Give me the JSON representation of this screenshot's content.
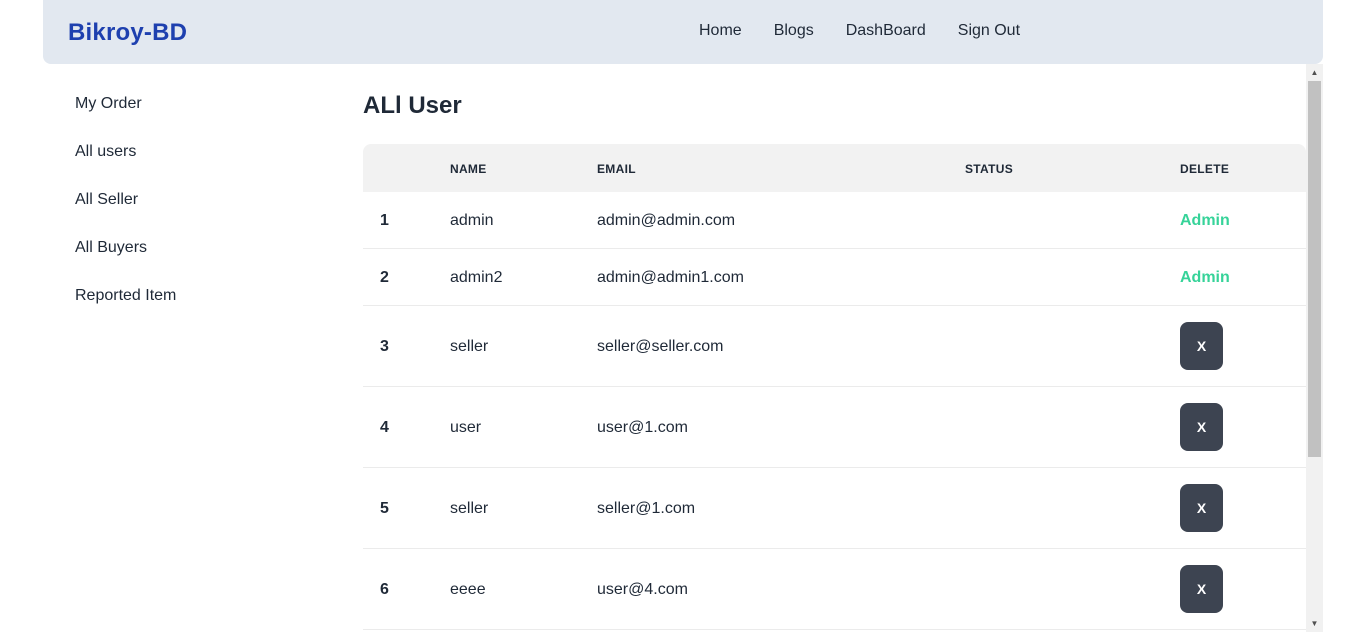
{
  "navbar": {
    "brand": "Bikroy-BD",
    "links": [
      "Home",
      "Blogs",
      "DashBoard",
      "Sign Out"
    ]
  },
  "sidebar": {
    "items": [
      "My Order",
      "All users",
      "All Seller",
      "All Buyers",
      "Reported Item"
    ]
  },
  "page": {
    "title": "ALl User"
  },
  "table": {
    "headers": [
      "",
      "NAME",
      "EMAIL",
      "STATUS",
      "DELETE"
    ],
    "rows": [
      {
        "index": "1",
        "name": "admin",
        "email": "admin@admin.com",
        "delete": "Admin"
      },
      {
        "index": "2",
        "name": "admin2",
        "email": "admin@admin1.com",
        "delete": "Admin"
      },
      {
        "index": "3",
        "name": "seller",
        "email": "seller@seller.com",
        "delete": "X"
      },
      {
        "index": "4",
        "name": "user",
        "email": "user@1.com",
        "delete": "X"
      },
      {
        "index": "5",
        "name": "seller",
        "email": "seller@1.com",
        "delete": "X"
      },
      {
        "index": "6",
        "name": "eeee",
        "email": "user@4.com",
        "delete": "X"
      }
    ]
  },
  "colors": {
    "brand": "#1e40af",
    "navbar_bg": "#e2e8f0",
    "admin_label": "#36d399",
    "delete_button": "#3d4451"
  },
  "icons": {
    "scroll_up": "scroll-up-arrow-icon",
    "scroll_down": "scroll-down-arrow-icon"
  }
}
